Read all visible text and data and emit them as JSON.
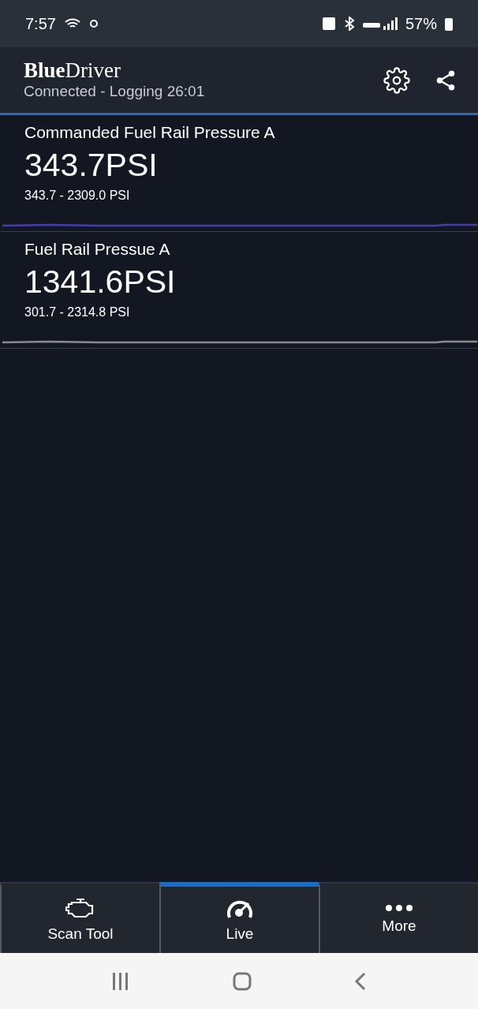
{
  "status_bar": {
    "time": "7:57",
    "battery": "57%"
  },
  "header": {
    "logo": "**Blue**Driver",
    "subtitle": "Connected - Logging 26:01"
  },
  "gauges": [
    {
      "name": "Commanded Fuel Rail Pressure A",
      "value": "343.7",
      "unit": "PSI",
      "range": "343.7 - 2309.0 PSI",
      "color": "#4a3ca8"
    },
    {
      "name": "Fuel Rail Pressue A",
      "value": "1341.6",
      "unit": "PSI",
      "range": "301.7 - 2314.8 PSI",
      "color": "#8a8a90"
    }
  ],
  "tabs": [
    {
      "kind": "engine",
      "label": "Scan Tool",
      "selected": false
    },
    {
      "kind": "gauge",
      "label": "Live",
      "selected": true
    },
    {
      "kind": "more",
      "label": "More",
      "selected": false
    }
  ]
}
